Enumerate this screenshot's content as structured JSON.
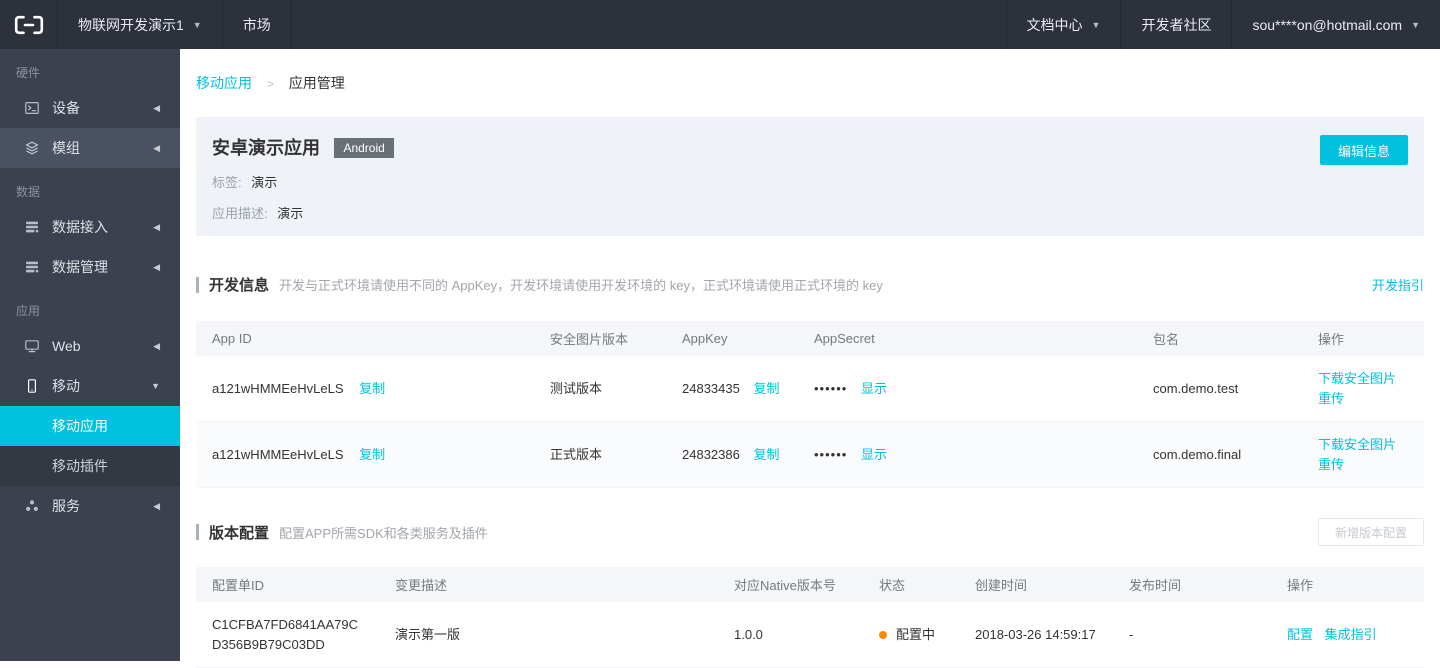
{
  "topbar": {
    "project_name": "物联网开发演示1",
    "market": "市场",
    "doc_center": "文档中心",
    "community": "开发者社区",
    "account_email": "sou****on@hotmail.com"
  },
  "sidebar": {
    "sections": [
      {
        "label": "硬件",
        "items": [
          {
            "label": "设备"
          },
          {
            "label": "模组"
          }
        ]
      },
      {
        "label": "数据",
        "items": [
          {
            "label": "数据接入"
          },
          {
            "label": "数据管理"
          }
        ]
      },
      {
        "label": "应用",
        "items": [
          {
            "label": "Web"
          },
          {
            "label": "移动",
            "children": [
              {
                "label": "移动应用"
              },
              {
                "label": "移动插件"
              }
            ]
          },
          {
            "label": "服务"
          }
        ]
      }
    ]
  },
  "breadcrumb": {
    "parent": "移动应用",
    "current": "应用管理"
  },
  "app_card": {
    "title": "安卓演示应用",
    "platform_badge": "Android",
    "tag_label": "标签:",
    "tag_value": "演示",
    "desc_label": "应用描述:",
    "desc_value": "演示",
    "edit_button": "编辑信息"
  },
  "dev_info": {
    "title": "开发信息",
    "subtitle": "开发与正式环境请使用不同的 AppKey，开发环境请使用开发环境的 key，正式环境请使用正式环境的 key",
    "guide_link": "开发指引",
    "table": {
      "headers": [
        "App ID",
        "安全图片版本",
        "AppKey",
        "AppSecret",
        "包名",
        "操作"
      ],
      "copy_label": "复制",
      "show_label": "显示",
      "secret_mask": "••••••",
      "download_label": "下载安全图片",
      "reupload_label": "重传",
      "rows": [
        {
          "app_id": "a121wHMMEeHvLeLS",
          "image_version": "测试版本",
          "app_key": "24833435",
          "package_name": "com.demo.test"
        },
        {
          "app_id": "a121wHMMEeHvLeLS",
          "image_version": "正式版本",
          "app_key": "24832386",
          "package_name": "com.demo.final"
        }
      ]
    }
  },
  "version_config": {
    "title": "版本配置",
    "subtitle": "配置APP所需SDK和各类服务及插件",
    "add_button": "新增版本配置",
    "table": {
      "headers": [
        "配置单ID",
        "变更描述",
        "对应Native版本号",
        "状态",
        "创建时间",
        "发布时间",
        "操作"
      ],
      "rows": [
        {
          "config_id": "C1CFBA7FD6841AA79CD356B9B79C03DD",
          "change_desc": "演示第一版",
          "native_version": "1.0.0",
          "status": "配置中",
          "created_at": "2018-03-26 14:59:17",
          "published_at": "-",
          "action_config": "配置",
          "action_guide": "集成指引"
        }
      ]
    }
  },
  "colors": {
    "accent": "#00c1de",
    "status_dot": "#ff8800",
    "topbar_bg": "#2c313c",
    "sidebar_bg": "#3b414e",
    "card_bg": "#eff3f8",
    "badge_bg": "#6a7078"
  }
}
